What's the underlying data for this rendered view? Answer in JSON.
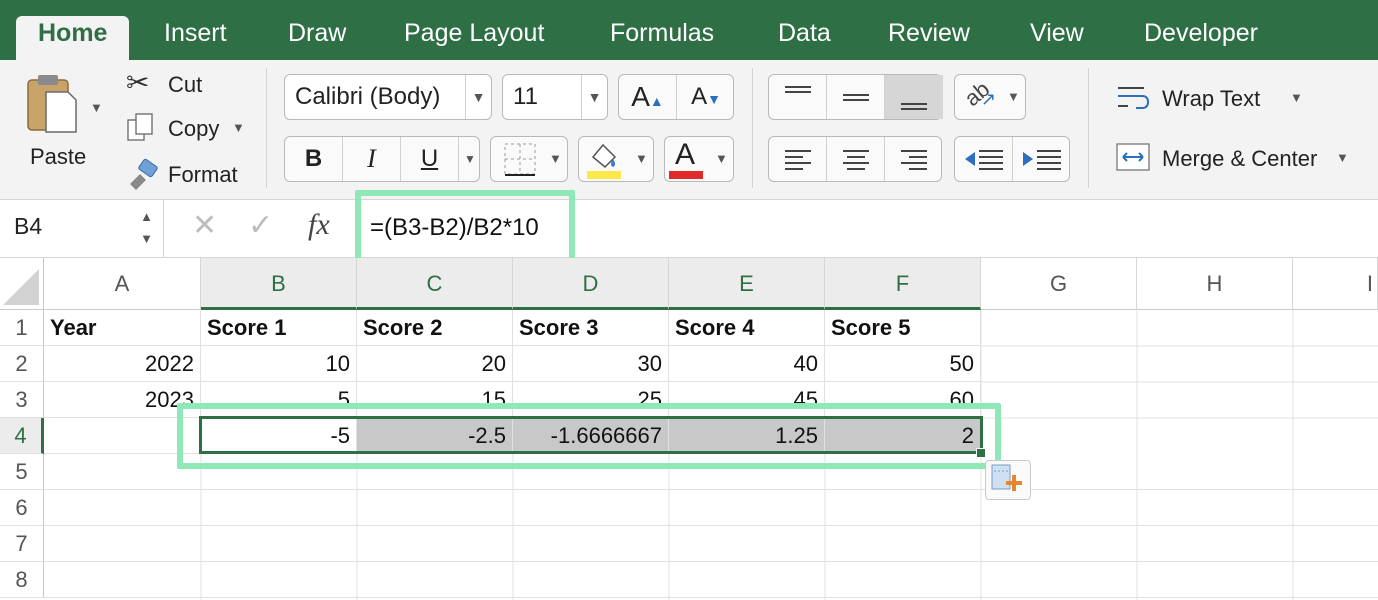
{
  "tabs": [
    "Home",
    "Insert",
    "Draw",
    "Page Layout",
    "Formulas",
    "Data",
    "Review",
    "View",
    "Developer"
  ],
  "clipboard": {
    "paste": "Paste",
    "cut": "Cut",
    "copy": "Copy",
    "format": "Format"
  },
  "font": {
    "name": "Calibri (Body)",
    "size": "11",
    "bold": "B",
    "italic": "I",
    "underline": "U",
    "grow": "A",
    "shrink": "A",
    "font_color_letter": "A"
  },
  "alignment": {
    "wrap_text": "Wrap Text",
    "merge_center": "Merge & Center"
  },
  "formula_bar": {
    "cell_ref": "B4",
    "fx": "fx",
    "formula": "=(B3-B2)/B2*10"
  },
  "colors": {
    "accent": "#2f6f45",
    "highlight": "#8fe8b8",
    "fill_color": "#ffe84a",
    "font_color": "#e02a2a"
  },
  "columns": [
    "A",
    "B",
    "C",
    "D",
    "E",
    "F",
    "G",
    "H",
    "I"
  ],
  "rows": [
    "1",
    "2",
    "3",
    "4",
    "5",
    "6",
    "7",
    "8"
  ],
  "cells": {
    "r1": [
      "Year",
      "Score 1",
      "Score 2",
      "Score 3",
      "Score 4",
      "Score 5"
    ],
    "r2": [
      "2022",
      "10",
      "20",
      "30",
      "40",
      "50"
    ],
    "r3": [
      "2023",
      "5",
      "15",
      "25",
      "45",
      "60"
    ],
    "r4": [
      "",
      "-5",
      "-2.5",
      "-1.6666667",
      "1.25",
      "2"
    ]
  }
}
